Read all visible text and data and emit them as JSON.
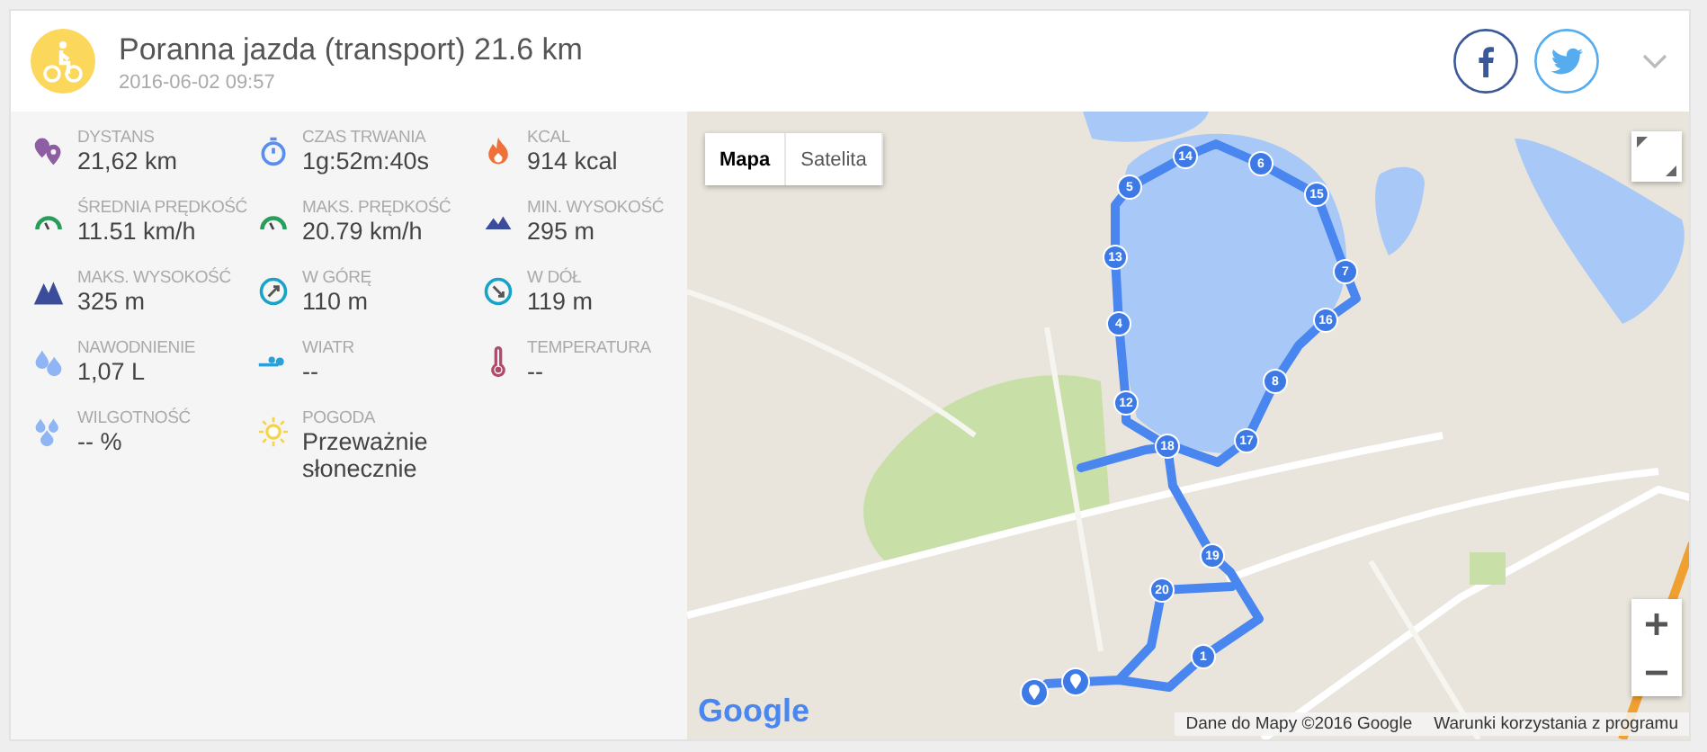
{
  "activity": {
    "title": "Poranna jazda (transport) 21.6 km",
    "date": "2016-06-02 09:57"
  },
  "stats": [
    {
      "kind": "distance",
      "label": "DYSTANS",
      "value": "21,62 km"
    },
    {
      "kind": "duration",
      "label": "CZAS TRWANIA",
      "value": "1g:52m:40s"
    },
    {
      "kind": "kcal",
      "label": "KCAL",
      "value": "914 kcal"
    },
    {
      "kind": "speed",
      "label": "ŚREDNIA PRĘDKOŚĆ",
      "value": "11.51 km/h"
    },
    {
      "kind": "speed",
      "label": "MAKS. PRĘDKOŚĆ",
      "value": "20.79 km/h"
    },
    {
      "kind": "mountain_small",
      "label": "MIN. WYSOKOŚĆ",
      "value": "295 m"
    },
    {
      "kind": "mountain",
      "label": "MAKS. WYSOKOŚĆ",
      "value": "325 m"
    },
    {
      "kind": "up",
      "label": "W GÓRĘ",
      "value": "110 m"
    },
    {
      "kind": "down",
      "label": "W DÓŁ",
      "value": "119 m"
    },
    {
      "kind": "drops",
      "label": "NAWODNIENIE",
      "value": "1,07 L"
    },
    {
      "kind": "wind",
      "label": "WIATR",
      "value": "--"
    },
    {
      "kind": "thermometer",
      "label": "TEMPERATURA",
      "value": "--"
    },
    {
      "kind": "humidity",
      "label": "WILGOTNOŚĆ",
      "value": "-- %"
    },
    {
      "kind": "sun",
      "label": "POGODA",
      "value": "Przeważnie słonecznie"
    }
  ],
  "map": {
    "types": [
      {
        "label": "Mapa",
        "selected": true
      },
      {
        "label": "Satelita",
        "selected": false
      }
    ],
    "markers": [
      "5",
      "14",
      "6",
      "15",
      "13",
      "7",
      "4",
      "16",
      "8",
      "12",
      "17",
      "18",
      "19",
      "20",
      "1"
    ],
    "logo": "Google",
    "attribution": "Dane do Mapy ©2016 Google",
    "terms": "Warunki korzystania z programu"
  }
}
